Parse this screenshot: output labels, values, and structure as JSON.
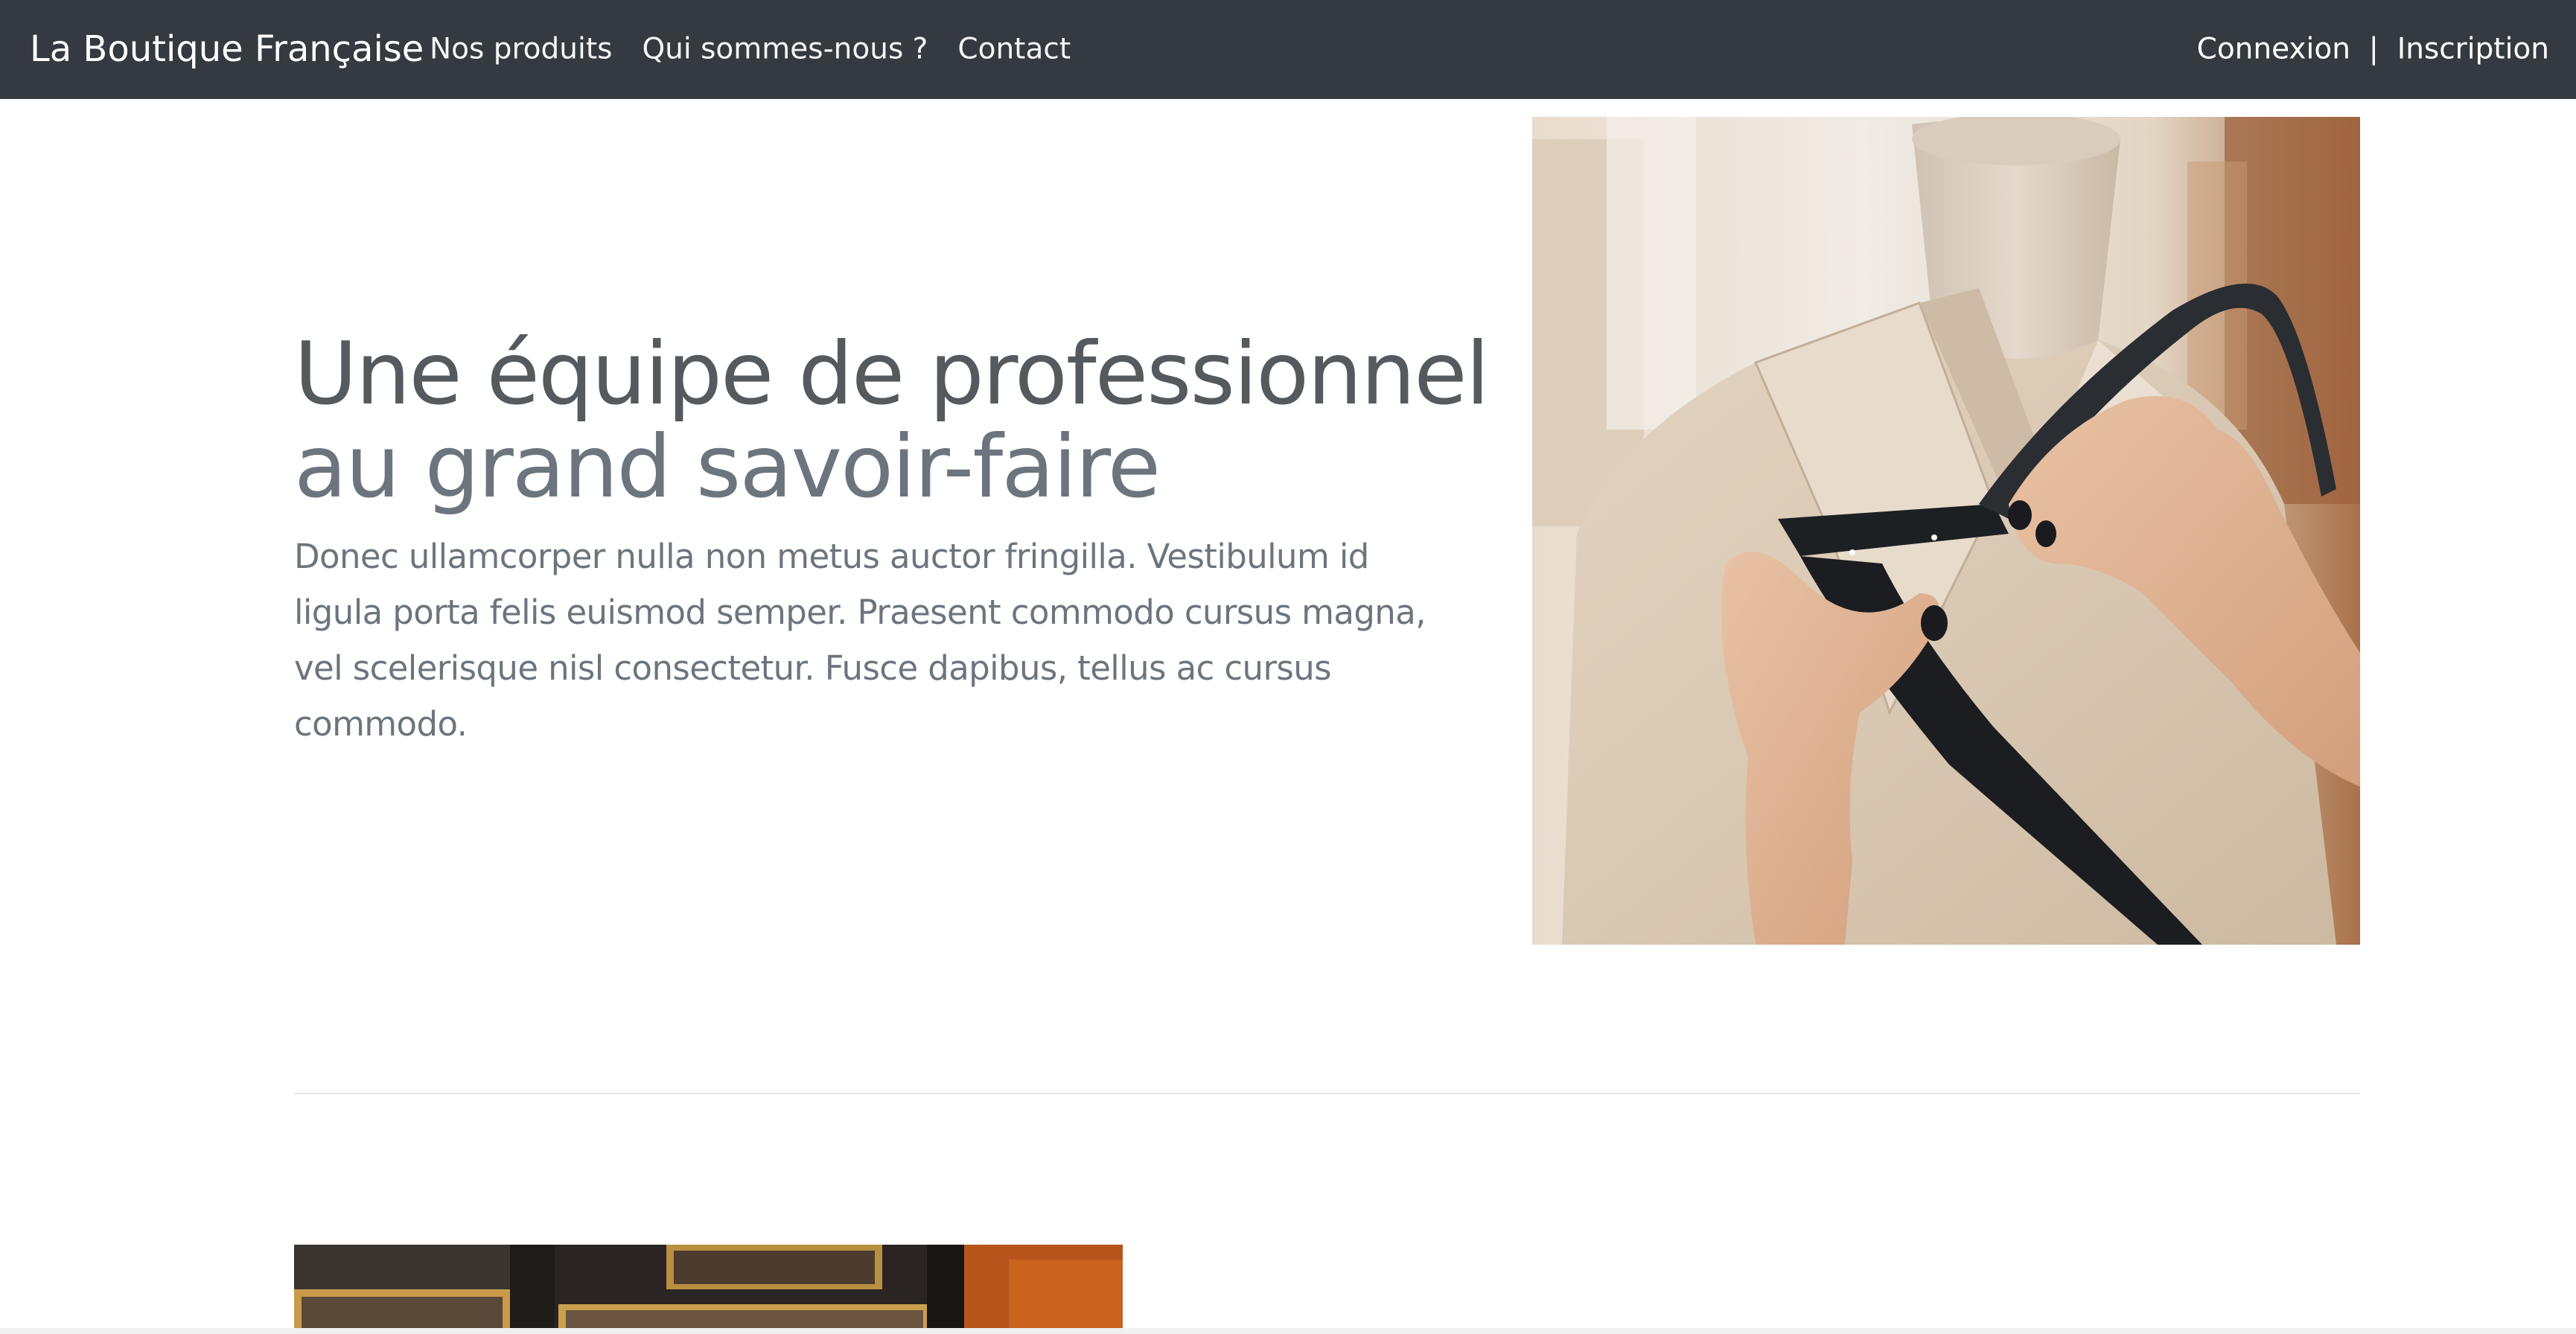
{
  "navbar": {
    "brand": "La Boutique Française",
    "links": [
      {
        "label": "Nos produits"
      },
      {
        "label": "Qui sommes-nous ?"
      },
      {
        "label": "Contact"
      }
    ],
    "auth": {
      "login": "Connexion",
      "separator": "|",
      "register": "Inscription"
    },
    "background_color": "#343a40"
  },
  "hero": {
    "title_line1": "Une équipe de professionnel",
    "title_line2": "au grand savoir-faire",
    "text": "Donec ullamcorper nulla non metus auctor fringilla. Vestibulum id ligula porta felis euismod semper. Praesent commodo cursus magna, vel scelerisque nisl consectetur. Fusce dapibus, tellus ac cursus commodo.",
    "image_icon": "tailor-mannequin-image"
  },
  "second_section": {
    "image_icon": "shop-window-image"
  }
}
